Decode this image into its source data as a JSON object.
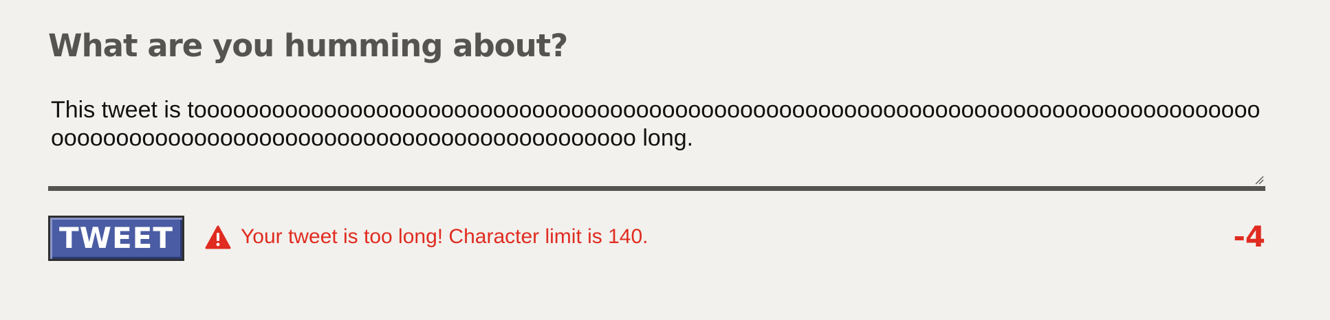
{
  "composer": {
    "heading": "What are you humming about?",
    "tweet_text": "This tweet is tooooooooooooooooooooooooooooooooooooooooooooooooooooooooooooooooooooooooooooooooooooooooooooooooooooooooooooooooooooooooooooooo long.",
    "button_label": "TWEET",
    "error_message": "Your tweet is too long! Character limit is 140.",
    "char_remaining": "-4",
    "icons": {
      "warning": "warning-triangle-icon",
      "resize": "resize-grip-icon"
    },
    "colors": {
      "background": "#f2f1ed",
      "heading": "#555450",
      "button": "#4a5ca3",
      "error": "#e02b20"
    }
  }
}
